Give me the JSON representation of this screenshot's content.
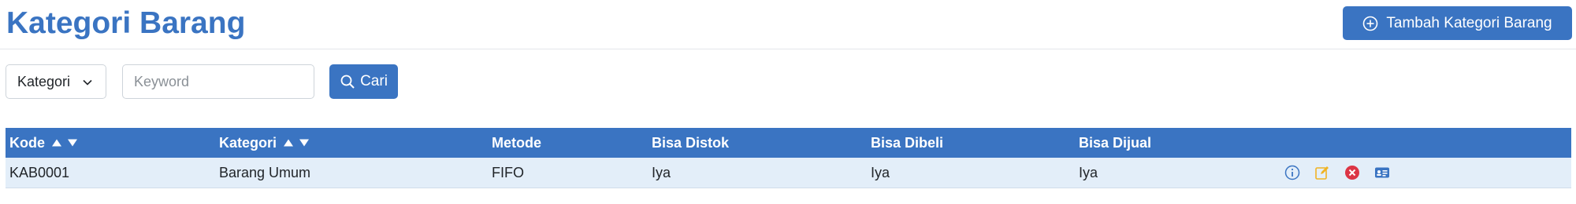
{
  "header": {
    "title": "Kategori Barang",
    "add_button_label": "Tambah Kategori Barang"
  },
  "filters": {
    "category_select": "Kategori",
    "keyword_placeholder": "Keyword",
    "keyword_value": "",
    "search_button_label": "Cari"
  },
  "table": {
    "columns": {
      "kode": "Kode",
      "kategori": "Kategori",
      "metode": "Metode",
      "bisa_distok": "Bisa Distok",
      "bisa_dibeli": "Bisa Dibeli",
      "bisa_dijual": "Bisa Dijual"
    },
    "rows": [
      {
        "kode": "KAB0001",
        "kategori": "Barang Umum",
        "metode": "FIFO",
        "bisa_distok": "Iya",
        "bisa_dibeli": "Iya",
        "bisa_dijual": "Iya"
      }
    ]
  },
  "colors": {
    "primary": "#3a74c2",
    "row_bg": "#e3eef9",
    "info_icon": "#3a74c2",
    "edit_icon": "#f0b323",
    "delete_icon": "#dc3545",
    "card_icon": "#3a74c2"
  },
  "icons": {
    "add": "plus-circle-icon",
    "search": "search-icon",
    "dropdown": "chevron-down-icon",
    "sort_asc": "sort-up-icon",
    "sort_desc": "sort-down-icon",
    "row_actions": [
      "info-icon",
      "edit-icon",
      "delete-icon",
      "id-card-icon"
    ]
  }
}
